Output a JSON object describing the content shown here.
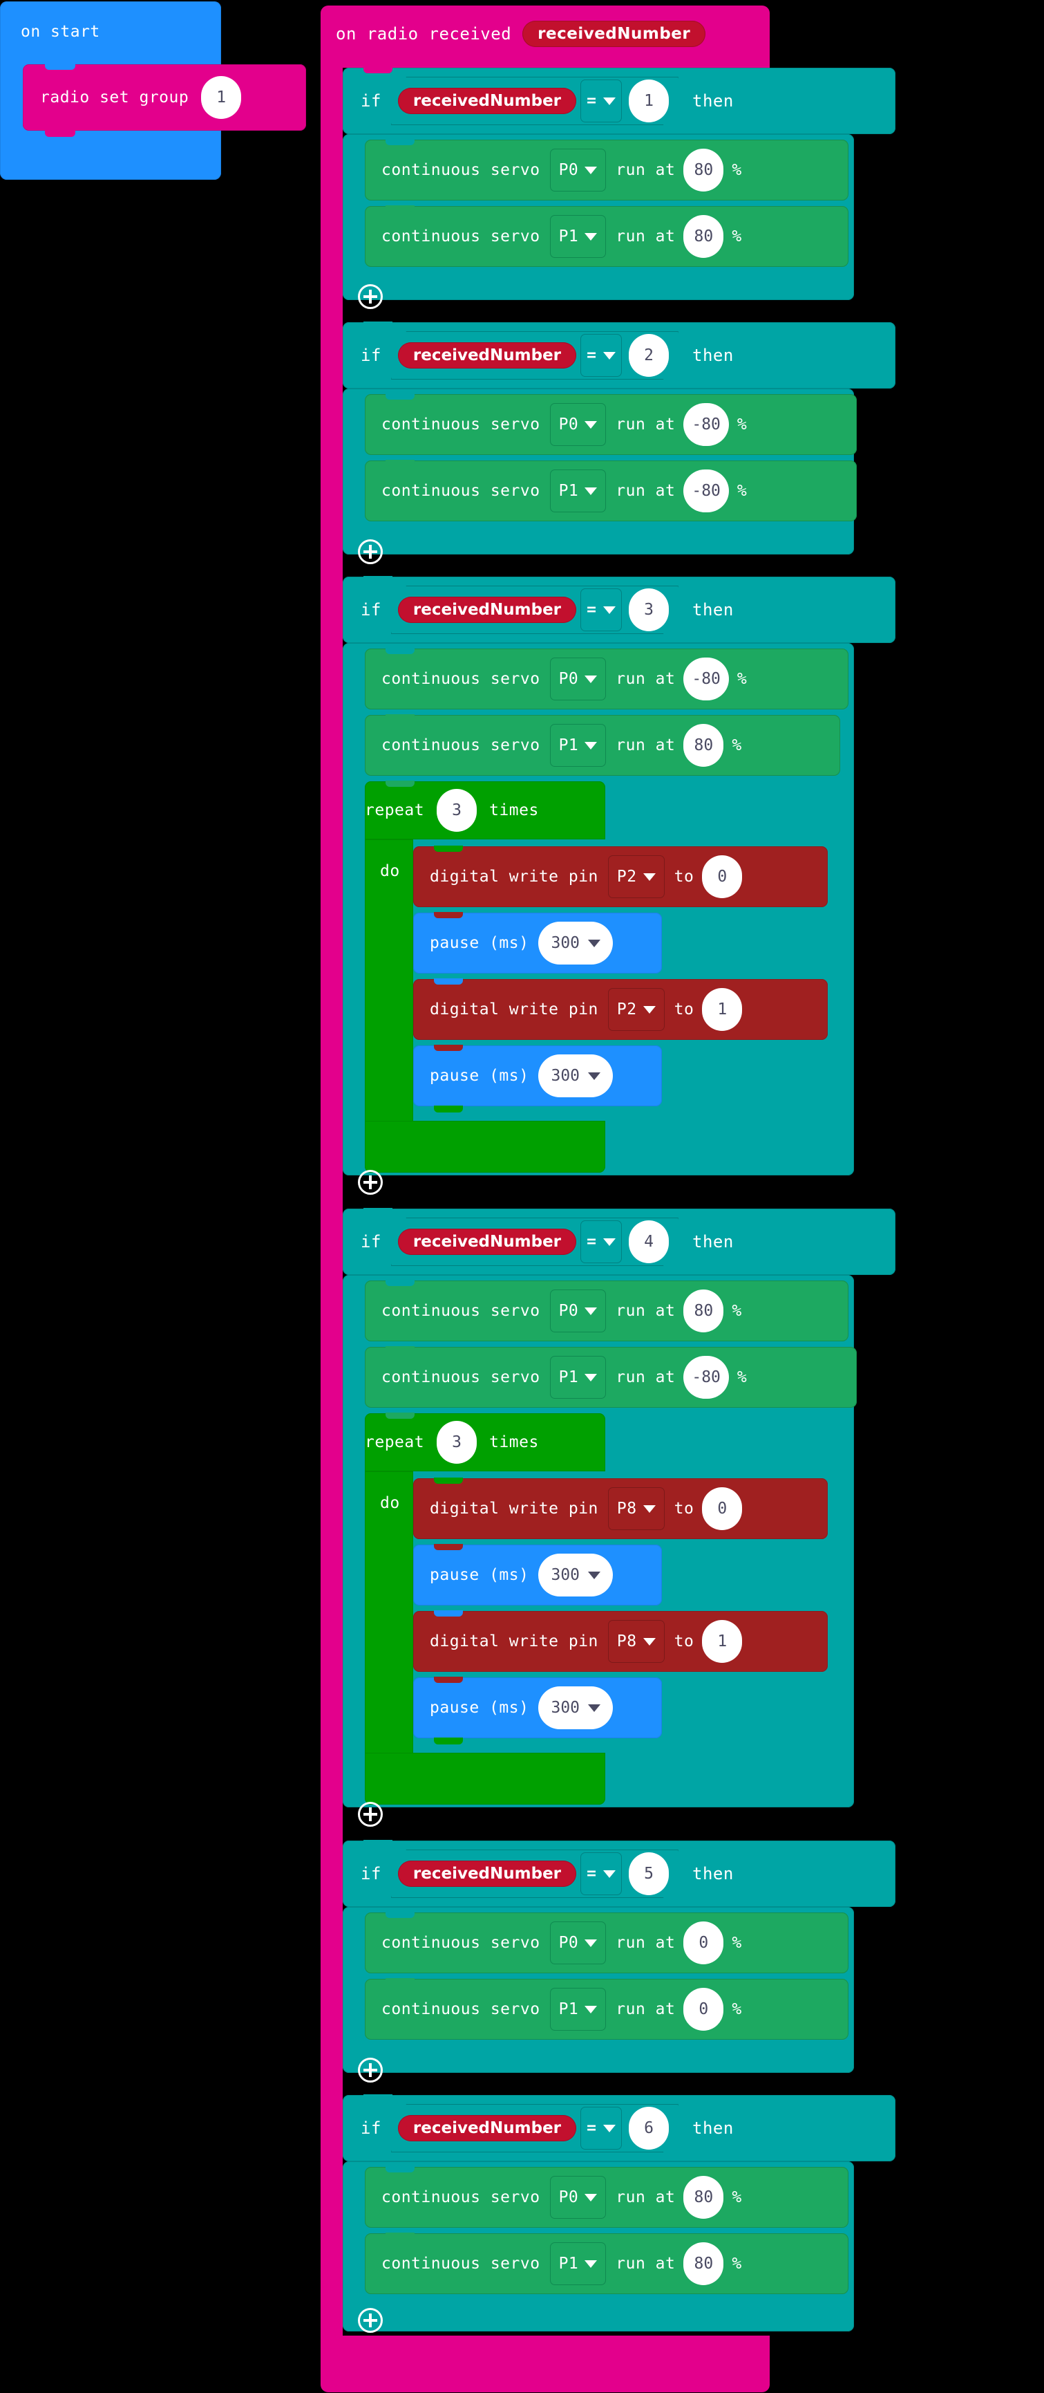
{
  "colors": {
    "background": "#000000",
    "event_blue": "#1E90FF",
    "radio_magenta": "#E3008C",
    "logic_teal": "#00A5A5",
    "servo_green": "#1DA961",
    "loop_green": "#00A000",
    "pins_red": "#A02020",
    "basic_blue": "#1E90FF",
    "variable_red": "#C2102E",
    "field_white": "#FFFFFF",
    "field_text": "#4A4A62"
  },
  "on_start": {
    "label": "on start",
    "radio_set_group": {
      "label": "radio set group",
      "value": "1"
    }
  },
  "on_radio_received": {
    "label": "on radio received",
    "parameter": "receivedNumber",
    "add_icon": "plus-circle-icon",
    "branches": [
      {
        "keyword_if": "if",
        "keyword_then": "then",
        "condition": {
          "variable": "receivedNumber",
          "operator": "=",
          "operator_caret": "chevron-down-icon",
          "value": "1"
        },
        "statements": [
          {
            "kind": "servo",
            "label": "continuous servo",
            "pin": "P0",
            "run_at_label": "run at",
            "speed": "80",
            "unit": "%"
          },
          {
            "kind": "servo",
            "label": "continuous servo",
            "pin": "P1",
            "run_at_label": "run at",
            "speed": "80",
            "unit": "%"
          }
        ]
      },
      {
        "keyword_if": "if",
        "keyword_then": "then",
        "condition": {
          "variable": "receivedNumber",
          "operator": "=",
          "operator_caret": "chevron-down-icon",
          "value": "2"
        },
        "statements": [
          {
            "kind": "servo",
            "label": "continuous servo",
            "pin": "P0",
            "run_at_label": "run at",
            "speed": "-80",
            "unit": "%"
          },
          {
            "kind": "servo",
            "label": "continuous servo",
            "pin": "P1",
            "run_at_label": "run at",
            "speed": "-80",
            "unit": "%"
          }
        ]
      },
      {
        "keyword_if": "if",
        "keyword_then": "then",
        "condition": {
          "variable": "receivedNumber",
          "operator": "=",
          "operator_caret": "chevron-down-icon",
          "value": "3"
        },
        "statements": [
          {
            "kind": "servo",
            "label": "continuous servo",
            "pin": "P0",
            "run_at_label": "run at",
            "speed": "-80",
            "unit": "%"
          },
          {
            "kind": "servo",
            "label": "continuous servo",
            "pin": "P1",
            "run_at_label": "run at",
            "speed": "80",
            "unit": "%"
          },
          {
            "kind": "repeat",
            "label": "repeat",
            "times": "3",
            "times_label": "times",
            "do_label": "do",
            "body": [
              {
                "kind": "digital_write",
                "label": "digital write pin",
                "pin": "P2",
                "to_label": "to",
                "value": "0"
              },
              {
                "kind": "pause",
                "label": "pause (ms)",
                "value": "300"
              },
              {
                "kind": "digital_write",
                "label": "digital write pin",
                "pin": "P2",
                "to_label": "to",
                "value": "1"
              },
              {
                "kind": "pause",
                "label": "pause (ms)",
                "value": "300"
              }
            ]
          }
        ]
      },
      {
        "keyword_if": "if",
        "keyword_then": "then",
        "condition": {
          "variable": "receivedNumber",
          "operator": "=",
          "operator_caret": "chevron-down-icon",
          "value": "4"
        },
        "statements": [
          {
            "kind": "servo",
            "label": "continuous servo",
            "pin": "P0",
            "run_at_label": "run at",
            "speed": "80",
            "unit": "%"
          },
          {
            "kind": "servo",
            "label": "continuous servo",
            "pin": "P1",
            "run_at_label": "run at",
            "speed": "-80",
            "unit": "%"
          },
          {
            "kind": "repeat",
            "label": "repeat",
            "times": "3",
            "times_label": "times",
            "do_label": "do",
            "body": [
              {
                "kind": "digital_write",
                "label": "digital write pin",
                "pin": "P8",
                "to_label": "to",
                "value": "0"
              },
              {
                "kind": "pause",
                "label": "pause (ms)",
                "value": "300"
              },
              {
                "kind": "digital_write",
                "label": "digital write pin",
                "pin": "P8",
                "to_label": "to",
                "value": "1"
              },
              {
                "kind": "pause",
                "label": "pause (ms)",
                "value": "300"
              }
            ]
          }
        ]
      },
      {
        "keyword_if": "if",
        "keyword_then": "then",
        "condition": {
          "variable": "receivedNumber",
          "operator": "=",
          "operator_caret": "chevron-down-icon",
          "value": "5"
        },
        "statements": [
          {
            "kind": "servo",
            "label": "continuous servo",
            "pin": "P0",
            "run_at_label": "run at",
            "speed": "0",
            "unit": "%"
          },
          {
            "kind": "servo",
            "label": "continuous servo",
            "pin": "P1",
            "run_at_label": "run at",
            "speed": "0",
            "unit": "%"
          }
        ]
      },
      {
        "keyword_if": "if",
        "keyword_then": "then",
        "condition": {
          "variable": "receivedNumber",
          "operator": "=",
          "operator_caret": "chevron-down-icon",
          "value": "6"
        },
        "statements": [
          {
            "kind": "servo",
            "label": "continuous servo",
            "pin": "P0",
            "run_at_label": "run at",
            "speed": "80",
            "unit": "%"
          },
          {
            "kind": "servo",
            "label": "continuous servo",
            "pin": "P1",
            "run_at_label": "run at",
            "speed": "80",
            "unit": "%"
          }
        ]
      }
    ]
  }
}
